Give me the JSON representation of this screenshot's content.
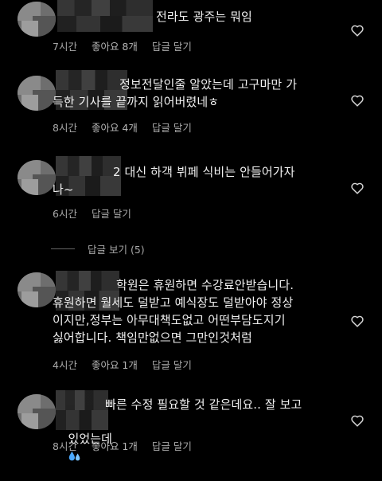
{
  "comments": [
    {
      "text": "전라도 광주는 뭐임",
      "time": "7시간",
      "likes": "좋아요 8개",
      "reply": "답글 달기"
    },
    {
      "text": "정보전달인줄 알았는데 고구마만 가득한 기사를 끝까지 읽어버렸네ㅎ",
      "line1": "정보전달인줄 알았는데 고구마만 가",
      "line2": "득한 기사를 끝까지 읽어버렸네ㅎ",
      "time": "8시간",
      "likes": "좋아요 4개",
      "reply": "답글 달기"
    },
    {
      "line1": "2 대신 하객 뷔페 식비는 안들어가자",
      "line2": "나~",
      "time": "6시간",
      "reply": "답글 달기"
    },
    {
      "line1": "학원은 휴원하면 수강료안받습니다.",
      "line2": "휴원하면 월세도 덜받고 예식장도 덜받아야 정상",
      "line3": "이지만,정부는 아무대책도없고 어떤부담도지기",
      "line4": "싫어합니다. 책임만없으면 그만인것처럼",
      "time": "4시간",
      "likes": "좋아요 1개",
      "reply": "답글 달기"
    },
    {
      "line1": "빠른 수정 필요할 것 같은데요.. 잘 보고",
      "line2": "있었는데",
      "time": "8시간",
      "likes": "좋아요 1개",
      "reply": "답글 달기"
    }
  ],
  "view_replies": "답글 보기 (5)",
  "icons": {
    "like": "heart-outline-icon",
    "emoji": "sweat-droplets-emoji"
  }
}
